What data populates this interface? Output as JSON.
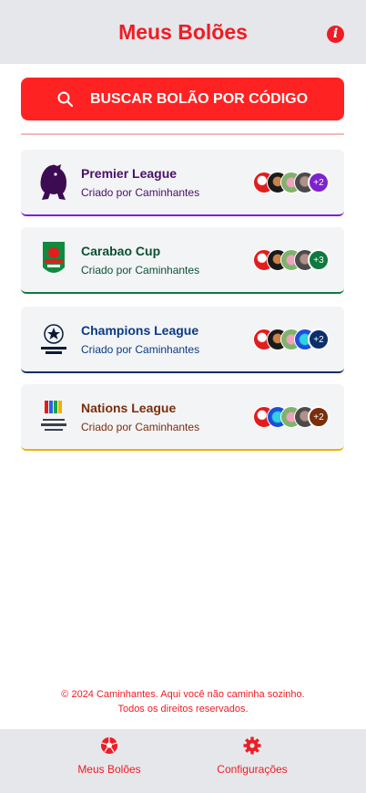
{
  "header": {
    "title": "Meus Bolões",
    "info_icon": "info-icon"
  },
  "search": {
    "label": "BUSCAR BOLÃO POR CÓDIGO",
    "icon": "search-icon"
  },
  "colors": {
    "brand": "#ef1c24"
  },
  "leagues": [
    {
      "name": "Premier League",
      "creator": "Criado por Caminhantes",
      "extra_members": "+2",
      "color": "#4b0f66",
      "accent": "#7e22ce"
    },
    {
      "name": "Carabao Cup",
      "creator": "Criado por Caminhantes",
      "extra_members": "+3",
      "color": "#0b5132",
      "accent": "#0f7a3f"
    },
    {
      "name": "Champions League",
      "creator": "Criado por Caminhantes",
      "extra_members": "+2",
      "color": "#0a3a86",
      "accent": "#0a2f6b"
    },
    {
      "name": "Nations League",
      "creator": "Criado por Caminhantes",
      "extra_members": "+2",
      "color": "#7a2e0b",
      "accent": "#eab308"
    }
  ],
  "footer": {
    "line1": "© 2024 Caminhantes. Aqui você não caminha sozinho.",
    "line2": "Todos os direitos reservados."
  },
  "nav": {
    "home_label": "Meus Bolões",
    "settings_label": "Configurações"
  }
}
